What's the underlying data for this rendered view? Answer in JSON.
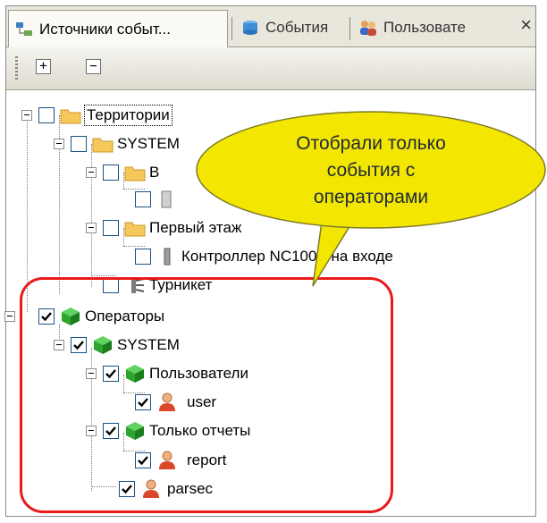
{
  "tabs": [
    {
      "label": "Источники событ...",
      "icon": "event-sources-icon",
      "active": true
    },
    {
      "label": "События",
      "icon": "events-db-icon",
      "active": false
    },
    {
      "label": "Пользовате",
      "icon": "users-icon",
      "active": false
    }
  ],
  "close_symbol": "×",
  "toolbar": {
    "expand_all": "+",
    "collapse_all": "−"
  },
  "tree": {
    "territories": "Территории",
    "system_territory": "SYSTEM",
    "area_b": "В",
    "first_floor": "Первый этаж",
    "controller": "Контроллер NC100K на входе",
    "turnstile": "Турникет",
    "operators": "Операторы",
    "system_operators": "SYSTEM",
    "users_group": "Пользователи",
    "user": "user",
    "reports_group": "Только отчеты",
    "report": "report",
    "parsec": "parsec"
  },
  "callout": {
    "line1": "Отобрали только",
    "line2": "события с",
    "line3": "операторами"
  },
  "colors": {
    "highlight": "#e81a1a",
    "callout_fill": "#f3e600",
    "operator_cube": "#2ea52e",
    "folder": "#f6c75a"
  }
}
